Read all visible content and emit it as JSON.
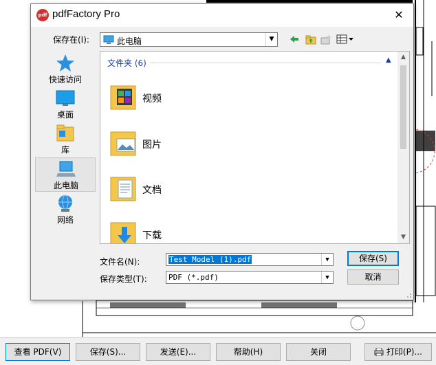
{
  "window": {
    "title": "pdfFactory Pro",
    "app_icon_text": "pdf",
    "close_glyph": "✕"
  },
  "save_in": {
    "label": "保存在(I):",
    "value": "此电脑"
  },
  "toolbar_icons": [
    "back-arrow-icon",
    "up-folder-icon",
    "new-folder-icon",
    "view-menu-icon"
  ],
  "places": [
    {
      "label": "快速访问",
      "icon": "star-icon"
    },
    {
      "label": "桌面",
      "icon": "desktop-icon"
    },
    {
      "label": "库",
      "icon": "library-icon"
    },
    {
      "label": "此电脑",
      "icon": "computer-icon",
      "selected": true
    },
    {
      "label": "网络",
      "icon": "network-icon"
    }
  ],
  "file_list": {
    "group_header": "文件夹 (6)",
    "items": [
      {
        "label": "视频",
        "icon": "videos-folder-icon"
      },
      {
        "label": "图片",
        "icon": "pictures-folder-icon"
      },
      {
        "label": "文档",
        "icon": "documents-folder-icon"
      },
      {
        "label": "下载",
        "icon": "downloads-folder-icon"
      }
    ]
  },
  "file_name": {
    "label": "文件名(N):",
    "value": "Test Model (1).pdf"
  },
  "file_type": {
    "label": "保存类型(T):",
    "value": "PDF (*.pdf)"
  },
  "buttons": {
    "save": "保存(S)",
    "cancel": "取消"
  },
  "bottom_bar": {
    "view_pdf": "查看 PDF(V)",
    "save": "保存(S)...",
    "send": "发送(E)...",
    "help": "帮助(H)",
    "close": "关闭",
    "print": "打印(P)..."
  },
  "colors": {
    "accent": "#0078d7",
    "group_header": "#1e3f99",
    "folder_yellow": "#f4c74c"
  }
}
